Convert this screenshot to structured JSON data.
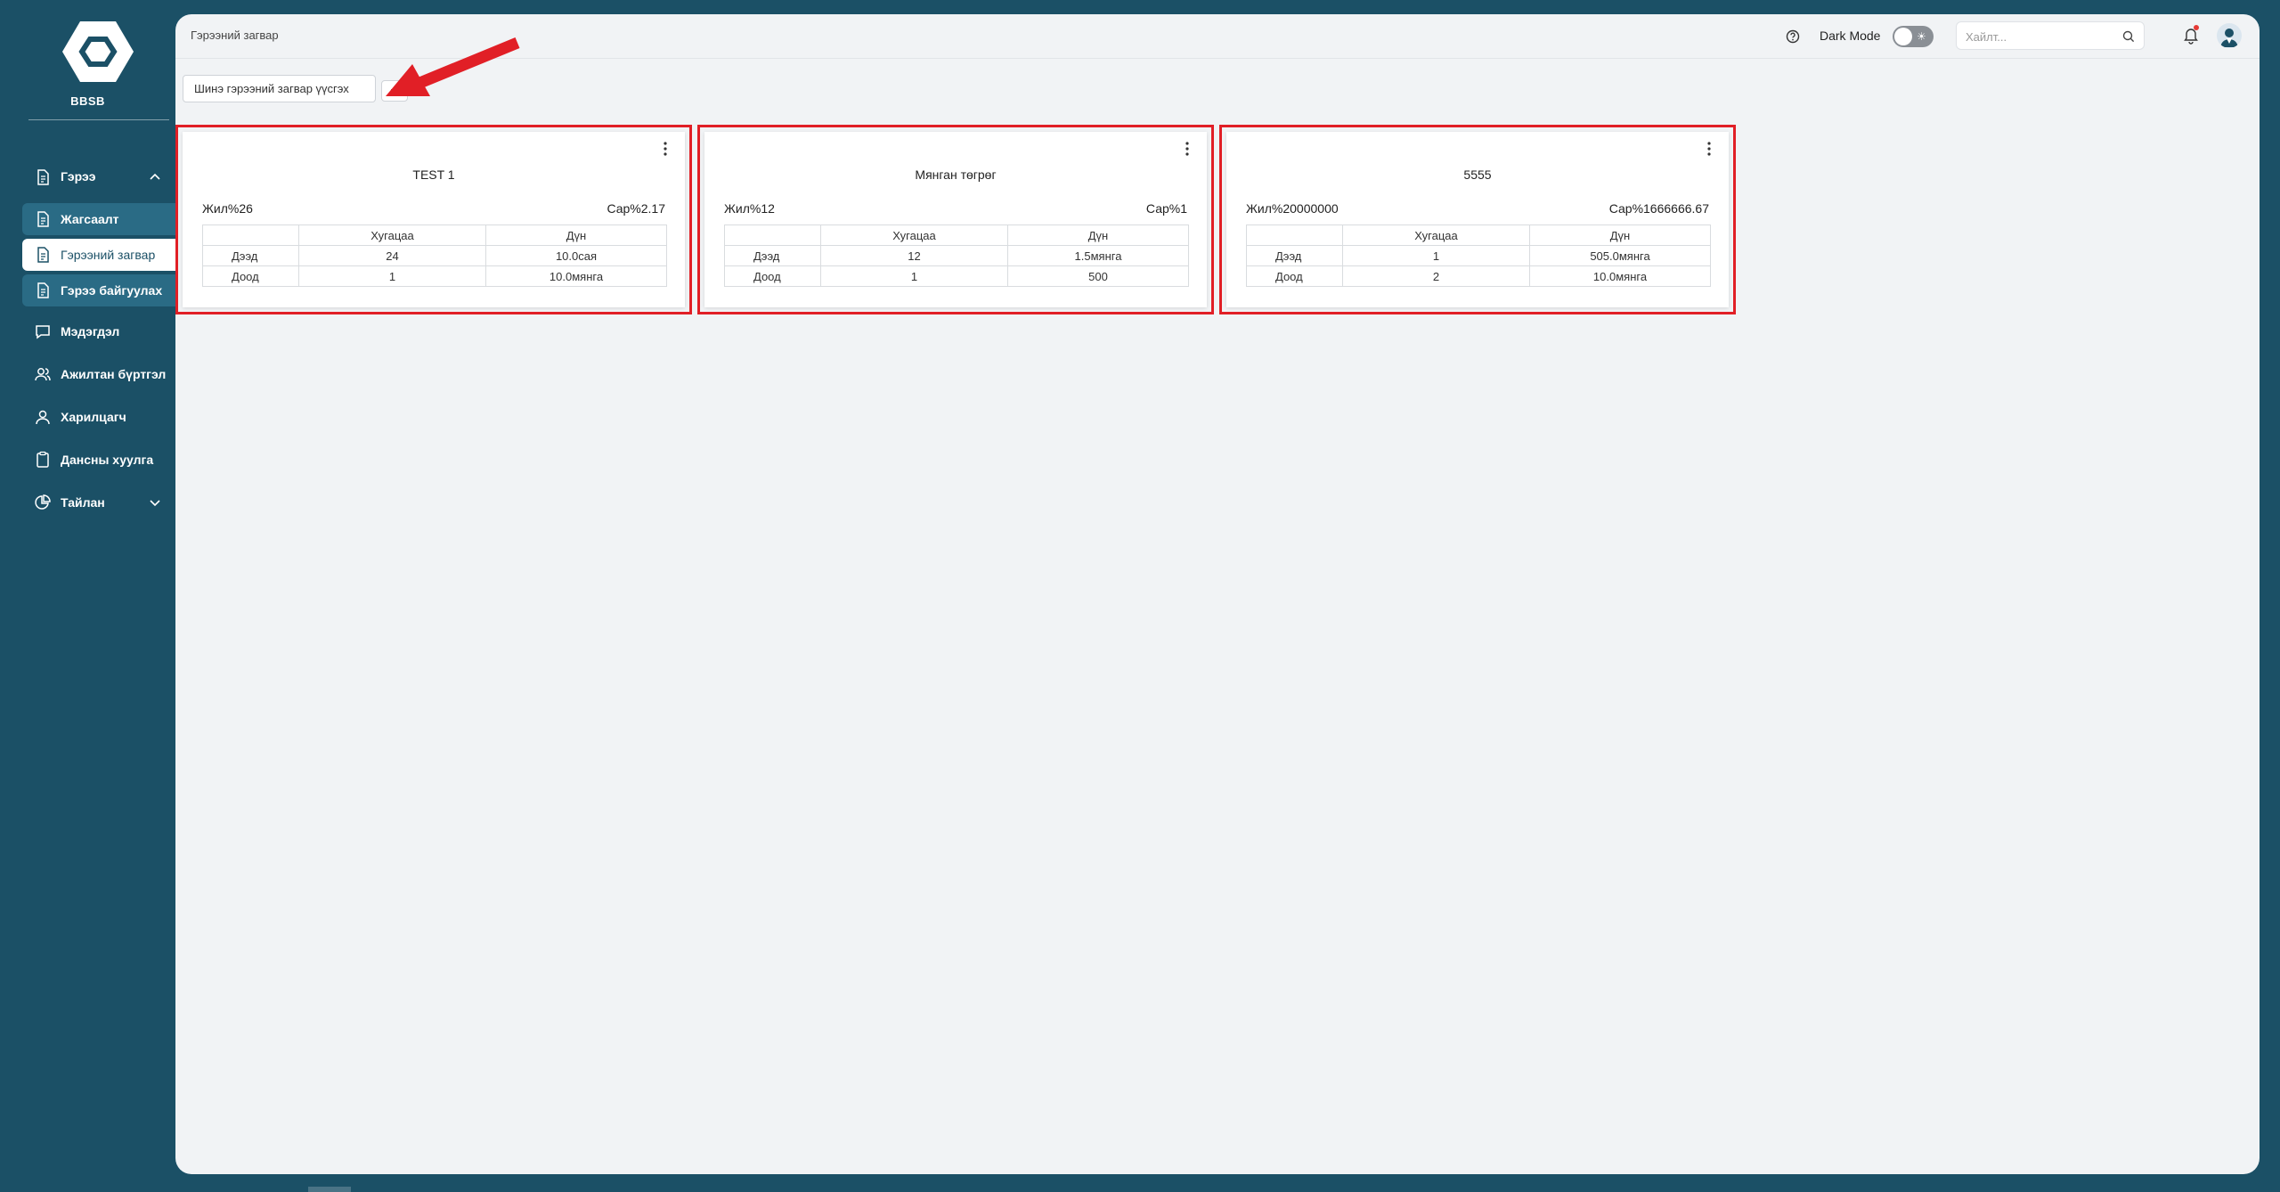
{
  "sidebar": {
    "brand": "BBSB",
    "items": [
      {
        "label": "Гэрээ",
        "icon": "document-icon",
        "expanded": true
      },
      {
        "label": "Жагсаалт",
        "icon": "document-icon"
      },
      {
        "label": "Гэрээний загвар",
        "icon": "document-icon",
        "active": true
      },
      {
        "label": "Гэрээ байгуулах",
        "icon": "document-icon"
      },
      {
        "label": "Мэдэгдэл",
        "icon": "chat-icon"
      },
      {
        "label": "Ажилтан бүртгэл",
        "icon": "users-icon"
      },
      {
        "label": "Харилцагч",
        "icon": "user-icon"
      },
      {
        "label": "Дансны хуулга",
        "icon": "clipboard-icon"
      },
      {
        "label": "Тайлан",
        "icon": "pie-chart-icon",
        "expanded": false
      }
    ]
  },
  "header": {
    "breadcrumb": "Гэрээний загвар",
    "dark_mode_label": "Dark Mode",
    "dark_mode_on": false,
    "search_placeholder": "Хайлт..."
  },
  "toolbar": {
    "template_name_value": "Шинэ гэрээний загвар үүсгэх",
    "add_label": "+"
  },
  "cards": [
    {
      "title": "TEST 1",
      "year_rate": "Жил%26",
      "month_rate": "Сар%2.17",
      "headers": [
        "",
        "Хугацаа",
        "Дүн"
      ],
      "rows": [
        [
          "Дээд",
          "24",
          "10.0сая"
        ],
        [
          "Доод",
          "1",
          "10.0мянга"
        ]
      ]
    },
    {
      "title": "Мянган төгрөг",
      "year_rate": "Жил%12",
      "month_rate": "Сар%1",
      "headers": [
        "",
        "Хугацаа",
        "Дүн"
      ],
      "rows": [
        [
          "Дээд",
          "12",
          "1.5мянга"
        ],
        [
          "Доод",
          "1",
          "500"
        ]
      ]
    },
    {
      "title": "5555",
      "year_rate": "Жил%20000000",
      "month_rate": "Сар%1666666.67",
      "headers": [
        "",
        "Хугацаа",
        "Дүн"
      ],
      "rows": [
        [
          "Дээд",
          "1",
          "505.0мянга"
        ],
        [
          "Доод",
          "2",
          "10.0мянга"
        ]
      ]
    }
  ],
  "colors": {
    "sidebar_bg": "#1b5066",
    "highlight_border": "#e11f26",
    "main_bg": "#f1f3f5"
  }
}
